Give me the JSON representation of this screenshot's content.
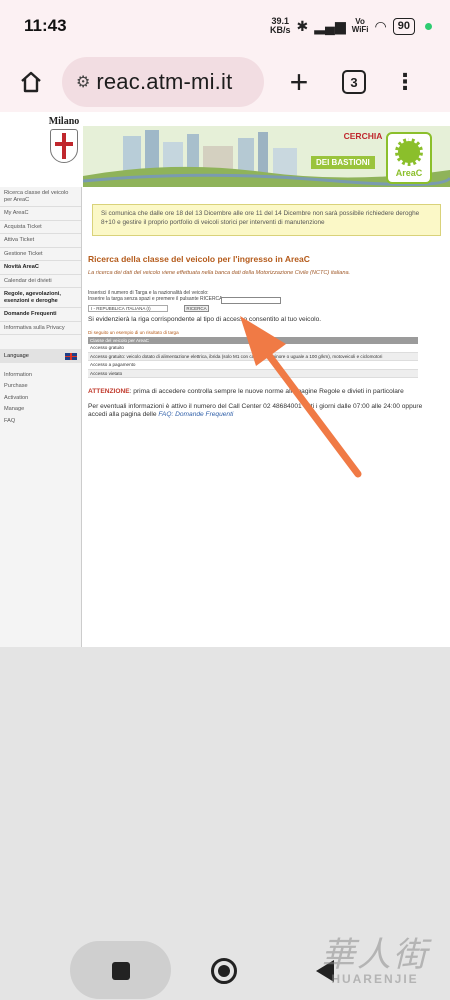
{
  "status_bar": {
    "time": "11:43",
    "net_speed_value": "39.1",
    "net_speed_unit": "KB/s",
    "wifi_label_top": "Vo",
    "wifi_label_bottom": "WiFi",
    "battery": "90"
  },
  "browser": {
    "url": "reac.atm-mi.it",
    "tab_count": "3"
  },
  "page": {
    "brand": "Milano",
    "banner_title": "CERCHIA",
    "banner_subtitle": "DEI BASTIONI",
    "logo_label": "AreaC",
    "sidebar": [
      "Ricerca classe del veicolo per AreaC",
      "My AreaC",
      "Acquista Ticket",
      "Attiva Ticket",
      "Gestione Ticket",
      "Novità AreaC",
      "Calendar dei divieti",
      "Regole, agevolazioni, esenzioni e deroghe",
      "Domande Frequenti",
      "Informativa sulla Privacy"
    ],
    "language_label": "Language",
    "english_menu": [
      "Information",
      "Purchase",
      "Activation",
      "Manage",
      "FAQ"
    ],
    "notice": "Si comunica che dalle ore 18 del 13 Dicembre alle ore 11 del 14 Dicembre non sarà possibile richiedere deroghe 8+10 e gestire il proprio portfolio di veicoli storici per interventi di manutenzione",
    "title": "Ricerca della classe del veicolo per l'ingresso in AreaC",
    "intro": "La ricerca dei dati del veicolo viene effettuata nella banca dati della Motorizzazione Civile (NCTC) italiana.",
    "form_line_1": "Inserisci il numero di Targa e la nazionalità del veicolo:",
    "form_line_2": "Inserire la targa senza spazi e premere il pulsante RICERCA.",
    "nation_value": "I - REPUBBLICA ITALIANA (I)",
    "search_button": "RICERCA",
    "highlight_note": "Si evidenzierà la riga corrispondente al tipo di accesso consentito al tuo veicolo.",
    "table_caption": "Di seguito un esempio di un risultato di targa",
    "table_header": "Classe del veicolo per AreaC",
    "table_rows": [
      "Accesso gratuito",
      "Accesso gratuito: veicolo dotato di alimentazione elettrica, ibrida (solo M1 con campo V7 minore o uguale a 100 g/km), motoveicoli e ciclomotori",
      "Accesso a pagamento",
      "Accesso vietato"
    ],
    "attention_label": "ATTENZIONE",
    "attention_text": ": prima di accedere controlla sempre le nuove norme alle pagine Regole e divieti in particolare",
    "info_text": "Per eventuali informazioni è attivo il numero del Call Center 02 48684001 tutti i giorni dalle 07:00 alle 24:00 oppure accedi alla pagina delle ",
    "info_link": "FAQ: Domande Frequenti"
  },
  "watermark": {
    "cn": "華人街",
    "en": "HUARENJIE"
  },
  "colors": {
    "arrow": "#f07a45",
    "title": "#b45a1a",
    "notice_bg": "#fbf8c7"
  }
}
